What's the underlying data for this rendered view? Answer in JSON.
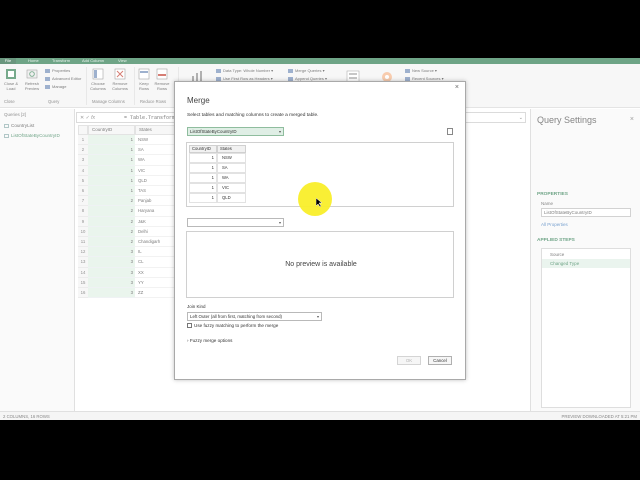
{
  "ribbon": {
    "tabs": [
      "File",
      "Home",
      "Transform",
      "Add Column",
      "View"
    ],
    "close_load": "Close & Load",
    "refresh_preview": "Refresh Preview",
    "properties": "Properties",
    "advanced_editor": "Advanced Editor",
    "manage": "Manage",
    "choose_columns": "Choose Columns",
    "remove_columns": "Remove Columns",
    "keep_rows": "Keep Rows",
    "remove_rows": "Remove Rows",
    "data_type": "Data Type: Whole Number",
    "use_first_row": "Use First Row as Headers",
    "merge_queries": "Merge Queries",
    "append_queries": "Append Queries",
    "new_source": "New Source",
    "recent_sources": "Recent Sources",
    "groups": {
      "close": "Close",
      "query": "Query",
      "manage_columns": "Manage Columns",
      "reduce_rows": "Reduce Rows"
    }
  },
  "queries": {
    "header": "Queries [2]",
    "items": [
      "CountryList",
      "ListOfStateByCountryID"
    ]
  },
  "formula": {
    "text": "= Table.TransformColumnTypes("
  },
  "grid": {
    "col1": "CountryID",
    "col2": "States",
    "rows": [
      {
        "n": "1",
        "id": "1",
        "state": "NSW"
      },
      {
        "n": "2",
        "id": "1",
        "state": "SA"
      },
      {
        "n": "3",
        "id": "1",
        "state": "WA"
      },
      {
        "n": "4",
        "id": "1",
        "state": "VIC"
      },
      {
        "n": "5",
        "id": "1",
        "state": "QLD"
      },
      {
        "n": "6",
        "id": "1",
        "state": "TAS"
      },
      {
        "n": "7",
        "id": "2",
        "state": "Panjab"
      },
      {
        "n": "8",
        "id": "2",
        "state": "Haryana"
      },
      {
        "n": "9",
        "id": "2",
        "state": "J&K"
      },
      {
        "n": "10",
        "id": "2",
        "state": "Delhi"
      },
      {
        "n": "11",
        "id": "2",
        "state": "Chandigarh"
      },
      {
        "n": "12",
        "id": "3",
        "state": "IL"
      },
      {
        "n": "13",
        "id": "3",
        "state": "CL"
      },
      {
        "n": "14",
        "id": "3",
        "state": "XX"
      },
      {
        "n": "15",
        "id": "3",
        "state": "YY"
      },
      {
        "n": "16",
        "id": "3",
        "state": "ZZ"
      }
    ]
  },
  "settings": {
    "title": "Query Settings",
    "properties": "PROPERTIES",
    "name_label": "Name",
    "name_value": "ListOfStateByCountryID",
    "all_properties": "All Properties",
    "applied_steps": "APPLIED STEPS",
    "steps": [
      "Source",
      "Changed Type"
    ]
  },
  "status": {
    "left": "2 COLUMNS, 16 ROWS",
    "right": "PREVIEW DOWNLOADED AT 5:21 PM"
  },
  "dialog": {
    "title": "Merge",
    "description": "Select tables and matching columns to create a merged table.",
    "table1": "ListOfStateByCountryID",
    "preview_cols": [
      "CountryID",
      "States"
    ],
    "preview_rows": [
      {
        "id": "1",
        "state": "NSW"
      },
      {
        "id": "1",
        "state": "SA"
      },
      {
        "id": "1",
        "state": "WA"
      },
      {
        "id": "1",
        "state": "VIC"
      },
      {
        "id": "1",
        "state": "QLD"
      }
    ],
    "table2": "",
    "no_preview": "No preview is available",
    "join_kind_label": "Join Kind",
    "join_kind_value": "Left Outer (all from first, matching from second)",
    "fuzzy_checkbox": "Use fuzzy matching to perform the merge",
    "fuzzy_options": "Fuzzy merge options",
    "ok": "OK",
    "cancel": "Cancel"
  },
  "colors": {
    "accent": "#217346",
    "highlight": "#f9ee2a",
    "selected_column": "#dff0e4"
  }
}
